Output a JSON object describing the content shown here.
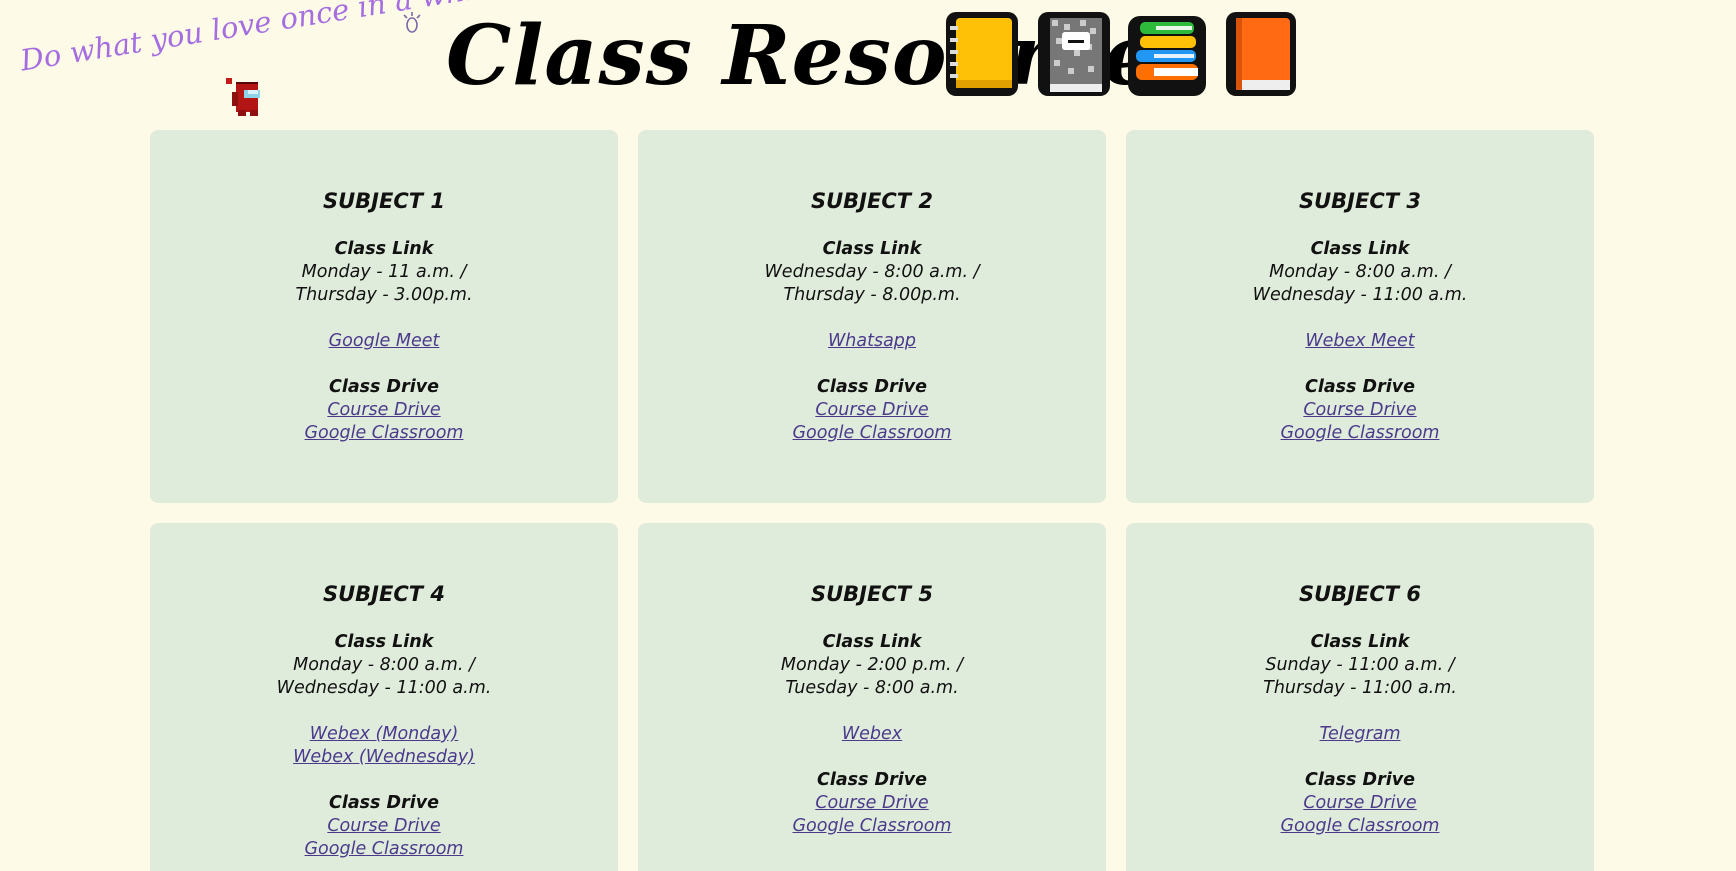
{
  "header": {
    "tagline": "Do what you love once in a while!",
    "title": "Class Resources",
    "icons": [
      "notebook-icon",
      "composition-notebook-icon",
      "books-stack-icon",
      "orange-book-icon",
      "sparkle-icon",
      "crewmate-icon"
    ]
  },
  "colors": {
    "background": "#fefae8",
    "card": "#e0ecdb",
    "link": "#4b3a8c",
    "tagline": "#a56ee0"
  },
  "subjects": [
    {
      "name": "SUBJECT 1",
      "class_link_label": "Class Link",
      "schedule": [
        "Monday - 11 a.m. /",
        "Thursday - 3.00p.m."
      ],
      "links": [
        "Google Meet"
      ],
      "drive_label": "Class Drive",
      "drive_links": [
        "Course Drive",
        "Google Classroom"
      ]
    },
    {
      "name": "SUBJECT 2",
      "class_link_label": "Class Link",
      "schedule": [
        "Wednesday - 8:00 a.m. /",
        "Thursday - 8.00p.m."
      ],
      "links": [
        "Whatsapp"
      ],
      "drive_label": "Class Drive",
      "drive_links": [
        "Course Drive",
        "Google Classroom"
      ]
    },
    {
      "name": "SUBJECT 3",
      "class_link_label": "Class Link",
      "schedule": [
        "Monday - 8:00 a.m. /",
        "Wednesday - 11:00 a.m."
      ],
      "links": [
        "Webex Meet"
      ],
      "drive_label": "Class Drive",
      "drive_links": [
        "Course Drive",
        "Google Classroom"
      ]
    },
    {
      "name": "SUBJECT 4",
      "class_link_label": "Class Link",
      "schedule": [
        "Monday - 8:00 a.m. /",
        "Wednesday - 11:00 a.m."
      ],
      "links": [
        "Webex (Monday)",
        "Webex (Wednesday)"
      ],
      "drive_label": "Class Drive",
      "drive_links": [
        "Course Drive",
        "Google Classroom"
      ]
    },
    {
      "name": "SUBJECT 5",
      "class_link_label": "Class Link",
      "schedule": [
        "Monday - 2:00 p.m. /",
        "Tuesday - 8:00 a.m."
      ],
      "links": [
        "Webex"
      ],
      "drive_label": "Class Drive",
      "drive_links": [
        "Course Drive",
        "Google Classroom"
      ]
    },
    {
      "name": "SUBJECT 6",
      "class_link_label": "Class Link",
      "schedule": [
        "Sunday - 11:00 a.m. /",
        "Thursday - 11:00 a.m."
      ],
      "links": [
        "Telegram"
      ],
      "drive_label": "Class Drive",
      "drive_links": [
        "Course Drive",
        "Google Classroom"
      ]
    }
  ]
}
